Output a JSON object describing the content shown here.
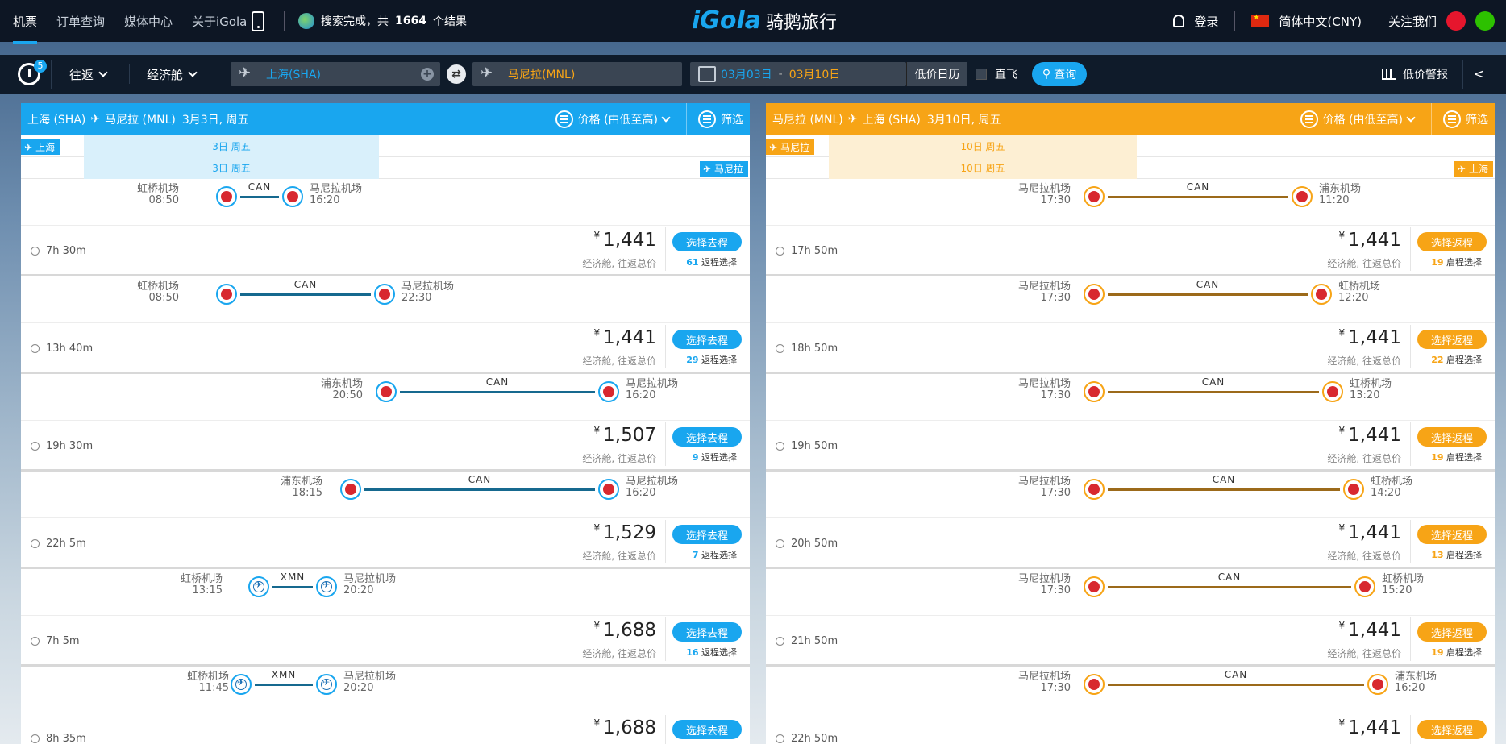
{
  "nav": {
    "items": [
      "机票",
      "订单查询",
      "媒体中心",
      "关于iGola"
    ],
    "search_status_prefix": "搜索完成，共",
    "search_status_count": "1664",
    "search_status_suffix": "个结果"
  },
  "logo": {
    "en": "iGola",
    "cn": "骑鹅旅行"
  },
  "topright": {
    "login": "登录",
    "currency": "简体中文(CNY)",
    "follow": "关注我们"
  },
  "searchbar": {
    "history_count": "5",
    "trip_type": "往返",
    "cabin": "经济舱",
    "from": "上海(SHA)",
    "to": "马尼拉(MNL)",
    "date_depart": "03月03日",
    "date_sep": "-",
    "date_return": "03月10日",
    "low_calendar": "低价日历",
    "direct": "直飞",
    "search": "查询",
    "alert": "低价警报"
  },
  "left": {
    "title_from": "上海 (SHA)",
    "title_to": "马尼拉 (MNL)",
    "title_date": "3月3日, 周五",
    "sort": "价格 (由低至高)",
    "filter": "筛选",
    "tag_top": "上海",
    "tag_bottom": "马尼拉",
    "date_top": "3日 周五",
    "date_bottom": "3日 周五",
    "button": "选择去程",
    "count_suffix": "返程选择",
    "fare_note": "经济舱, 往返总价",
    "flights": [
      {
        "dep_ap": "虹桥机场",
        "dep_t": "08:50",
        "arr_ap": "马尼拉机场",
        "arr_t": "16:20",
        "stop": "CAN",
        "dur": "7h 30m",
        "price": "1,441",
        "count": "61",
        "airline": "cs"
      },
      {
        "dep_ap": "虹桥机场",
        "dep_t": "08:50",
        "arr_ap": "马尼拉机场",
        "arr_t": "22:30",
        "stop": "CAN",
        "dur": "13h 40m",
        "price": "1,441",
        "count": "29",
        "airline": "cs"
      },
      {
        "dep_ap": "浦东机场",
        "dep_t": "20:50",
        "arr_ap": "马尼拉机场",
        "arr_t": "16:20",
        "stop": "CAN",
        "dur": "19h 30m",
        "price": "1,507",
        "count": "9",
        "airline": "cs"
      },
      {
        "dep_ap": "浦东机场",
        "dep_t": "18:15",
        "arr_ap": "马尼拉机场",
        "arr_t": "16:20",
        "stop": "CAN",
        "dur": "22h 5m",
        "price": "1,529",
        "count": "7",
        "airline": "cs"
      },
      {
        "dep_ap": "虹桥机场",
        "dep_t": "13:15",
        "arr_ap": "马尼拉机场",
        "arr_t": "20:20",
        "stop": "XMN",
        "dur": "7h 5m",
        "price": "1,688",
        "count": "16",
        "airline": "xm"
      },
      {
        "dep_ap": "虹桥机场",
        "dep_t": "11:45",
        "arr_ap": "马尼拉机场",
        "arr_t": "20:20",
        "stop": "XMN",
        "dur": "8h 35m",
        "price": "1,688",
        "count": "",
        "airline": "xm"
      }
    ]
  },
  "right": {
    "title_from": "马尼拉 (MNL)",
    "title_to": "上海 (SHA)",
    "title_date": "3月10日, 周五",
    "sort": "价格 (由低至高)",
    "filter": "筛选",
    "tag_top": "马尼拉",
    "tag_bottom": "上海",
    "date_top": "10日 周五",
    "date_bottom": "10日 周五",
    "button": "选择返程",
    "count_suffix": "启程选择",
    "fare_note": "经济舱, 往返总价",
    "flights": [
      {
        "dep_ap": "马尼拉机场",
        "dep_t": "17:30",
        "arr_ap": "浦东机场",
        "arr_t": "11:20",
        "stop": "CAN",
        "dur": "17h 50m",
        "price": "1,441",
        "count": "19"
      },
      {
        "dep_ap": "马尼拉机场",
        "dep_t": "17:30",
        "arr_ap": "虹桥机场",
        "arr_t": "12:20",
        "stop": "CAN",
        "dur": "18h 50m",
        "price": "1,441",
        "count": "22"
      },
      {
        "dep_ap": "马尼拉机场",
        "dep_t": "17:30",
        "arr_ap": "虹桥机场",
        "arr_t": "13:20",
        "stop": "CAN",
        "dur": "19h 50m",
        "price": "1,441",
        "count": "19"
      },
      {
        "dep_ap": "马尼拉机场",
        "dep_t": "17:30",
        "arr_ap": "虹桥机场",
        "arr_t": "14:20",
        "stop": "CAN",
        "dur": "20h 50m",
        "price": "1,441",
        "count": "13"
      },
      {
        "dep_ap": "马尼拉机场",
        "dep_t": "17:30",
        "arr_ap": "虹桥机场",
        "arr_t": "15:20",
        "stop": "CAN",
        "dur": "21h 50m",
        "price": "1,441",
        "count": "19"
      },
      {
        "dep_ap": "马尼拉机场",
        "dep_t": "17:30",
        "arr_ap": "浦东机场",
        "arr_t": "16:20",
        "stop": "CAN",
        "dur": "22h 50m",
        "price": "1,441",
        "count": ""
      }
    ]
  },
  "colors": {
    "blue": "#19a6ef",
    "orange": "#f7a416",
    "dark": "#0d1624"
  }
}
